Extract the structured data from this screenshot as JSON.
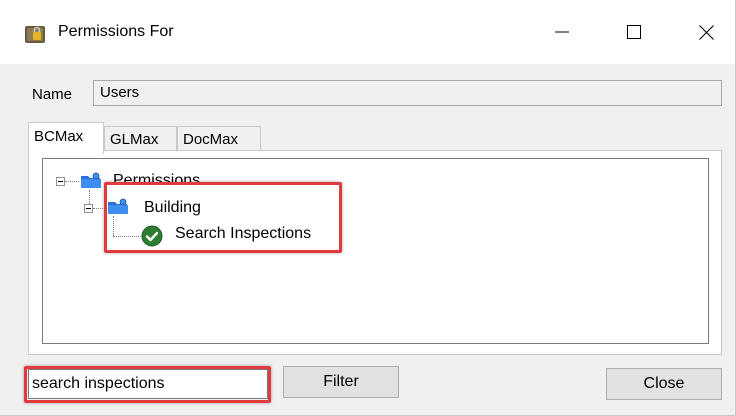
{
  "window": {
    "title": "Permissions For",
    "icon": "lock-app-icon"
  },
  "name_row": {
    "label": "Name",
    "value": "Users"
  },
  "tabs": [
    {
      "label": "BCMax",
      "active": true
    },
    {
      "label": "GLMax",
      "active": false
    },
    {
      "label": "DocMax",
      "active": false
    }
  ],
  "tree": {
    "root": {
      "label": "Permissions",
      "icon": "folder-network-icon",
      "expanded": true,
      "children": [
        {
          "label": "Building",
          "icon": "folder-network-icon",
          "expanded": true,
          "children": [
            {
              "label": "Search Inspections",
              "icon": "green-check-icon"
            }
          ]
        }
      ]
    }
  },
  "filter": {
    "value": "search inspections",
    "button_label": "Filter"
  },
  "close_button_label": "Close",
  "colors": {
    "highlight": "#e0393e",
    "check_green": "#2e7d32"
  }
}
